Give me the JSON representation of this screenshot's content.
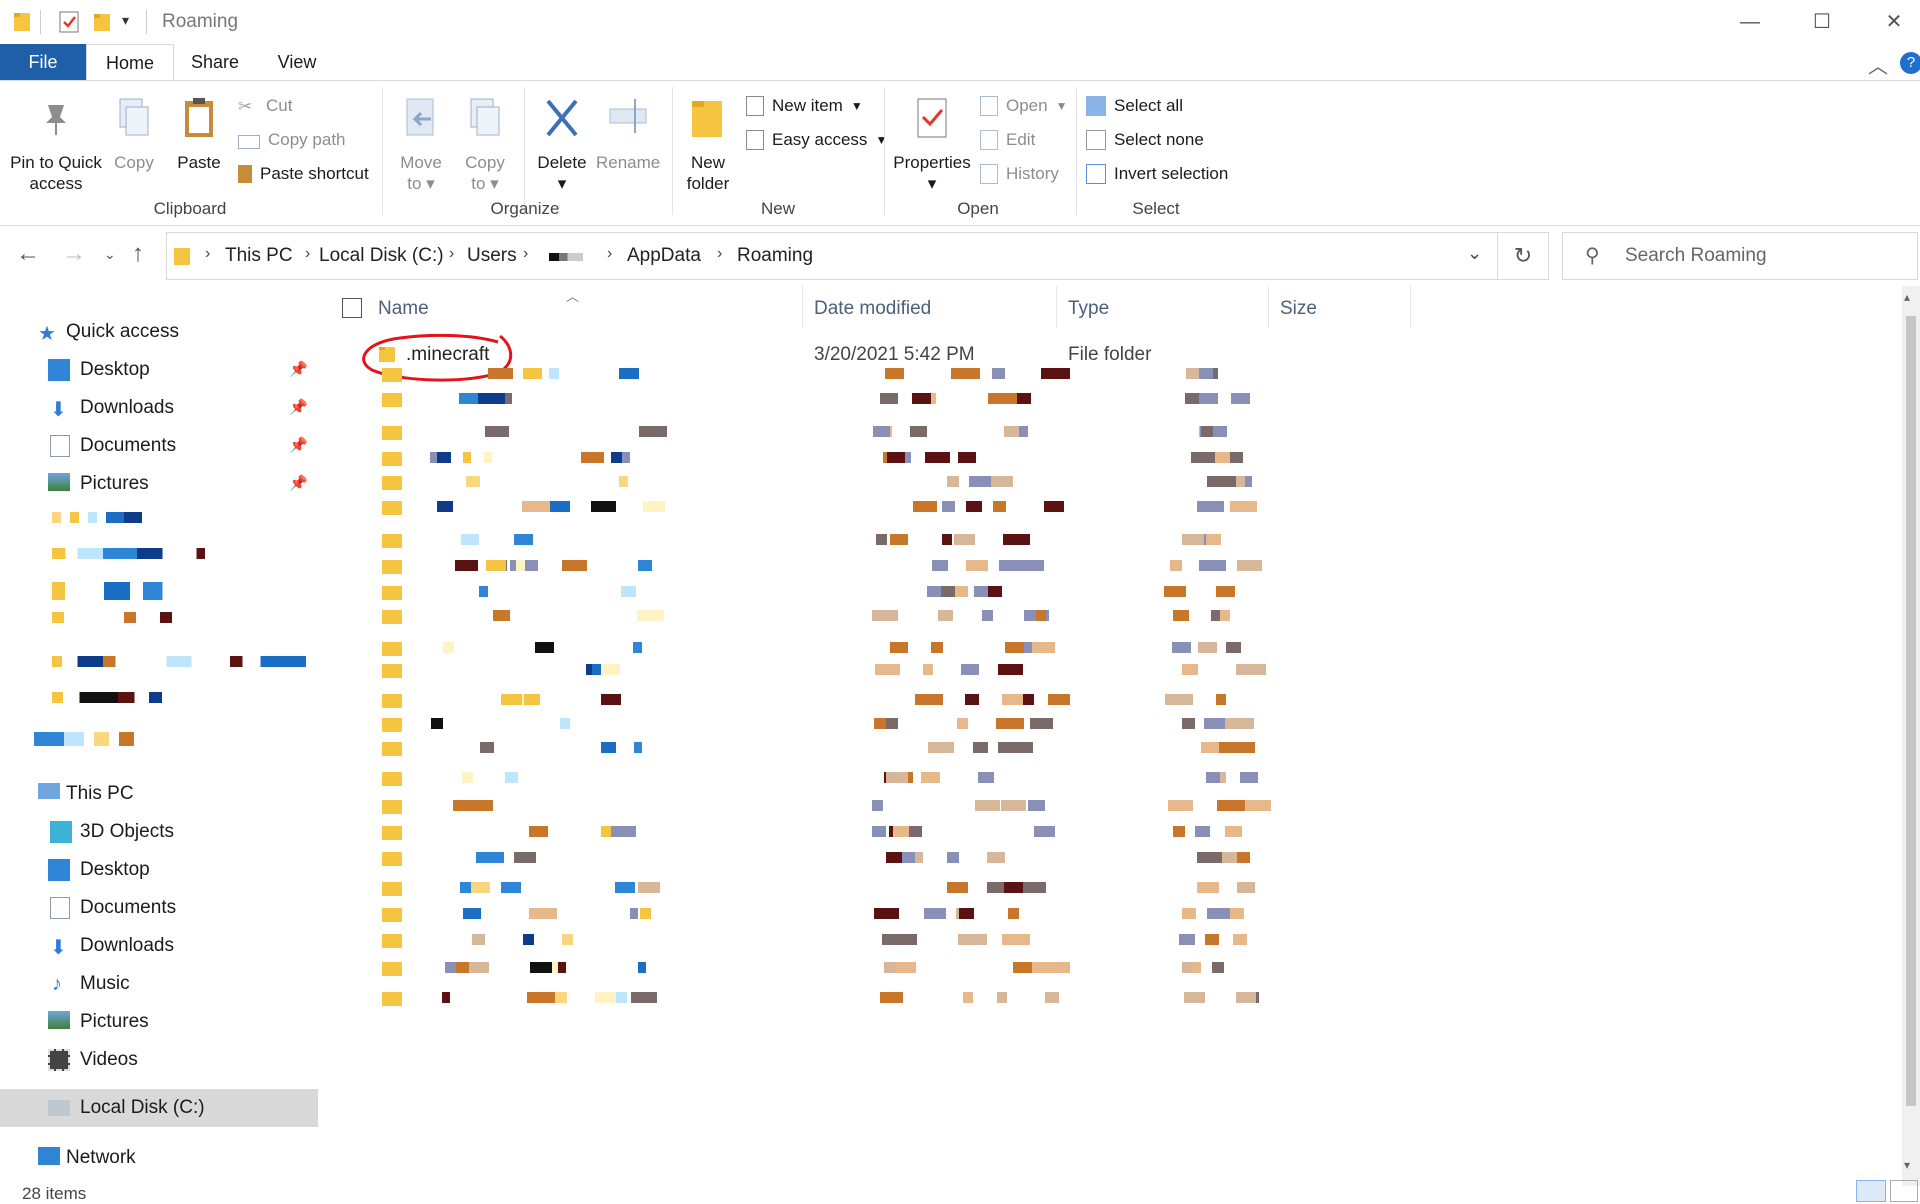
{
  "window": {
    "title": "Roaming",
    "controls": [
      "minimize",
      "maximize",
      "close"
    ]
  },
  "ribbon_tabs": [
    {
      "label": "File"
    },
    {
      "label": "Home"
    },
    {
      "label": "Share"
    },
    {
      "label": "View"
    }
  ],
  "ribbon": {
    "clipboard": {
      "pin_label_1": "Pin to Quick",
      "pin_label_2": "access",
      "copy": "Copy",
      "paste": "Paste",
      "cut": "Cut",
      "copy_path": "Copy path",
      "paste_shortcut": "Paste shortcut",
      "group": "Clipboard"
    },
    "organize": {
      "move_1": "Move",
      "move_2": "to",
      "copy_1": "Copy",
      "copy_2": "to",
      "delete": "Delete",
      "rename": "Rename",
      "group": "Organize"
    },
    "new": {
      "new_folder_1": "New",
      "new_folder_2": "folder",
      "new_item": "New item",
      "easy_access": "Easy access",
      "group": "New"
    },
    "open": {
      "properties": "Properties",
      "open": "Open",
      "edit": "Edit",
      "history": "History",
      "group": "Open"
    },
    "select": {
      "select_all": "Select all",
      "select_none": "Select none",
      "invert_selection": "Invert selection",
      "group": "Select"
    }
  },
  "address": {
    "crumbs": [
      "This PC",
      "Local Disk (C:)",
      "Users",
      "AppData",
      "Roaming"
    ],
    "search_placeholder": "Search Roaming"
  },
  "sidebar": {
    "quick_access": "Quick access",
    "pinned": [
      "Desktop",
      "Downloads",
      "Documents",
      "Pictures"
    ],
    "this_pc": "This PC",
    "this_pc_items": [
      "3D Objects",
      "Desktop",
      "Documents",
      "Downloads",
      "Music",
      "Pictures",
      "Videos",
      "Local Disk (C:)"
    ],
    "network": "Network"
  },
  "columns": {
    "name": "Name",
    "date": "Date modified",
    "type": "Type",
    "size": "Size"
  },
  "files": [
    {
      "name": ".minecraft",
      "date": "3/20/2021 5:42 PM",
      "type": "File folder",
      "highlighted": true
    }
  ],
  "status": {
    "items": "28 items"
  }
}
